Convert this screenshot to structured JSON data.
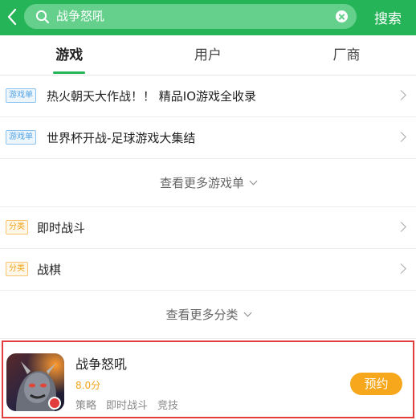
{
  "colors": {
    "brand_green": "#26b458",
    "search_bg": "#65cf8c",
    "highlight_red": "#e23c3c",
    "accent_orange": "#f6a71b",
    "tag_blue": "#56a4e4"
  },
  "search": {
    "query": "战争怒吼",
    "button_label": "搜索",
    "icon": "search-icon"
  },
  "tabs": [
    {
      "label": "游戏",
      "active": true
    },
    {
      "label": "用户",
      "active": false
    },
    {
      "label": "厂商",
      "active": false
    }
  ],
  "game_lists": [
    {
      "tag": "游戏单",
      "title": "热火朝天大作战！！ 精品IO游戏全收录"
    },
    {
      "tag": "游戏单",
      "title": "世界杯开战-足球游戏大集结"
    }
  ],
  "more_game_lists": "查看更多游戏单",
  "categories": [
    {
      "tag": "分类",
      "title": "即时战斗"
    },
    {
      "tag": "分类",
      "title": "战棋"
    }
  ],
  "more_categories": "查看更多分类",
  "game": {
    "name": "战争怒吼",
    "score": "8.0分",
    "tags": [
      "策略",
      "即时战斗",
      "竞技"
    ],
    "action_label": "预约"
  }
}
